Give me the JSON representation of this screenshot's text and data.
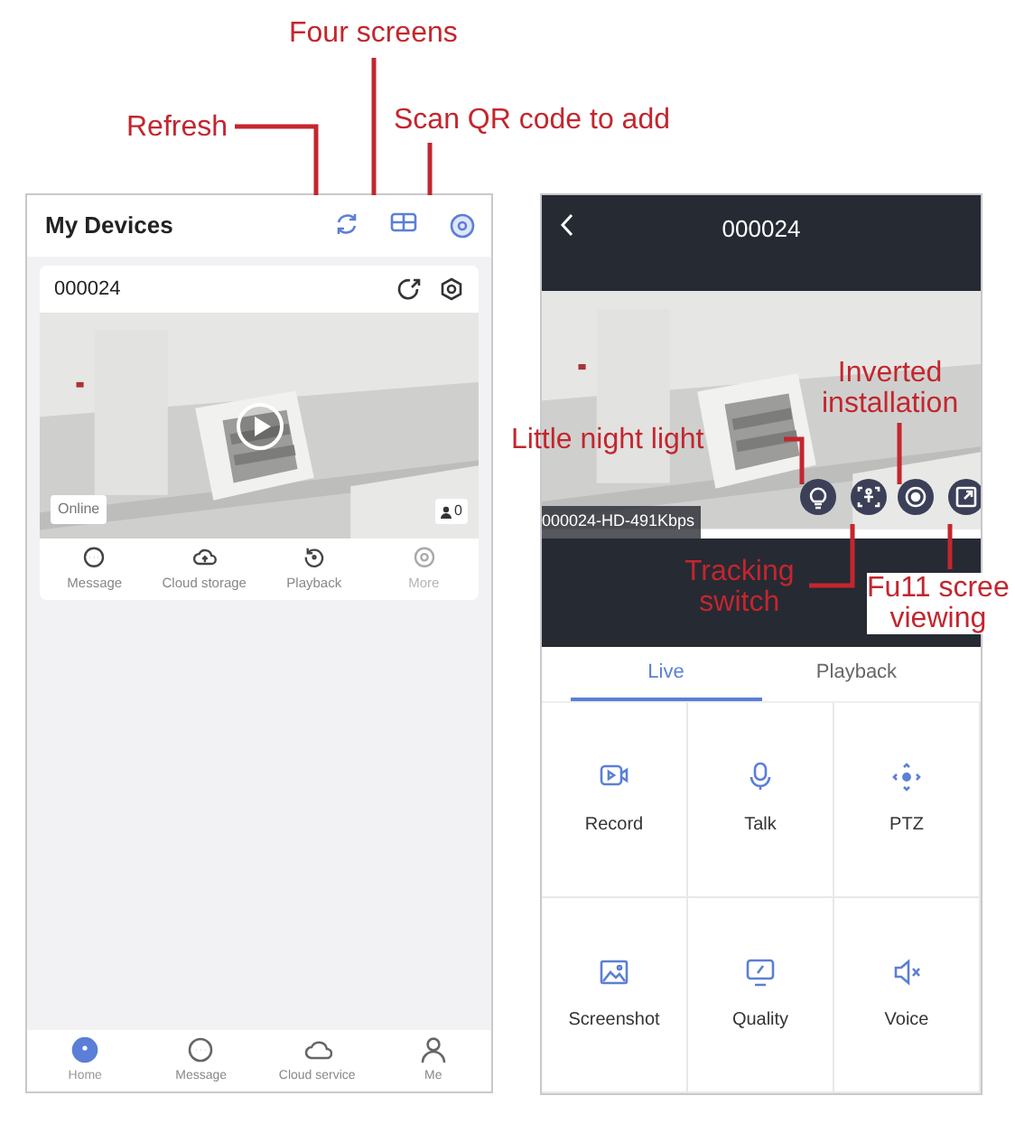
{
  "annotations": [
    {
      "lines": [
        "Four screens"
      ]
    },
    {
      "lines": [
        "Refresh"
      ]
    },
    {
      "lines": [
        "Scan QR code to add"
      ]
    },
    {
      "lines": [
        "Little night light"
      ]
    },
    {
      "lines": [
        "Inverted",
        "installation"
      ]
    },
    {
      "lines": [
        "Tracking",
        "switch"
      ]
    },
    {
      "lines": [
        "Fu11 scree",
        "viewing"
      ]
    }
  ],
  "device_list": {
    "title": "My Devices",
    "device": {
      "name": "000024",
      "status": "Online",
      "viewers": "0",
      "actions": [
        {
          "label": "Message",
          "disabled": false
        },
        {
          "label": "Cloud storage",
          "disabled": false
        },
        {
          "label": "Playback",
          "disabled": false
        },
        {
          "label": "More",
          "disabled": true
        }
      ]
    },
    "nav": [
      {
        "label": "Home",
        "selected": true
      },
      {
        "label": "Message",
        "selected": false
      },
      {
        "label": "Cloud service",
        "selected": false
      },
      {
        "label": "Me",
        "selected": false
      }
    ]
  },
  "live_view": {
    "title": "000024",
    "stream": "000024-HD-491Kbps",
    "tabs": [
      {
        "label": "Live",
        "selected": true
      },
      {
        "label": "Playback",
        "selected": false
      }
    ],
    "functions": [
      {
        "label": "Record"
      },
      {
        "label": "Talk"
      },
      {
        "label": "PTZ"
      },
      {
        "label": "Screenshot"
      },
      {
        "label": "Quality"
      },
      {
        "label": "Voice"
      }
    ]
  }
}
